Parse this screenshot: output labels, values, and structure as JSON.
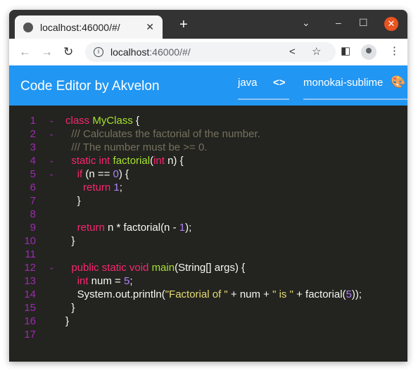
{
  "browser": {
    "tab_title": "localhost:46000/#/",
    "url_host": "localhost",
    "url_rest": ":46000/#/"
  },
  "header": {
    "title": "Code Editor by Akvelon",
    "language": "java",
    "theme": "monokai-sublime"
  },
  "colors": {
    "header": "#2196f3",
    "editor_bg": "#23241f",
    "keyword": "#f92672",
    "function": "#a6e22e",
    "comment": "#75715e",
    "number": "#ae81ff",
    "string": "#e6db74"
  },
  "code": [
    {
      "n": "1",
      "fold": true,
      "t": [
        [
          "kw",
          "class "
        ],
        [
          "fn",
          "MyClass"
        ],
        [
          "tx",
          " {"
        ]
      ]
    },
    {
      "n": "2",
      "fold": true,
      "t": [
        [
          "cm",
          "  /// Calculates the factorial of the number."
        ]
      ]
    },
    {
      "n": "3",
      "fold": false,
      "t": [
        [
          "cm",
          "  /// The number must be >= 0."
        ]
      ]
    },
    {
      "n": "4",
      "fold": true,
      "t": [
        [
          "kw",
          "  static int "
        ],
        [
          "fn",
          "factorial"
        ],
        [
          "tx",
          "("
        ],
        [
          "kw",
          "int"
        ],
        [
          "tx",
          " n) {"
        ]
      ]
    },
    {
      "n": "5",
      "fold": true,
      "t": [
        [
          "kw",
          "    if"
        ],
        [
          "tx",
          " (n == "
        ],
        [
          "num",
          "0"
        ],
        [
          "tx",
          ") {"
        ]
      ]
    },
    {
      "n": "6",
      "fold": false,
      "t": [
        [
          "kw",
          "      return "
        ],
        [
          "num",
          "1"
        ],
        [
          "tx",
          ";"
        ]
      ]
    },
    {
      "n": "7",
      "fold": false,
      "t": [
        [
          "tx",
          "    }"
        ]
      ]
    },
    {
      "n": "8",
      "fold": false,
      "t": []
    },
    {
      "n": "9",
      "fold": false,
      "t": [
        [
          "kw",
          "    return"
        ],
        [
          "tx",
          " n * factorial(n - "
        ],
        [
          "num",
          "1"
        ],
        [
          "tx",
          ");"
        ]
      ]
    },
    {
      "n": "10",
      "fold": false,
      "t": [
        [
          "tx",
          "  }"
        ]
      ]
    },
    {
      "n": "11",
      "fold": false,
      "t": []
    },
    {
      "n": "12",
      "fold": true,
      "t": [
        [
          "kw",
          "  public static void "
        ],
        [
          "fn",
          "main"
        ],
        [
          "tx",
          "(String[] args) {"
        ]
      ]
    },
    {
      "n": "13",
      "fold": false,
      "t": [
        [
          "kw",
          "    int"
        ],
        [
          "tx",
          " num = "
        ],
        [
          "num",
          "5"
        ],
        [
          "tx",
          ";"
        ]
      ]
    },
    {
      "n": "14",
      "fold": false,
      "t": [
        [
          "tx",
          "    System.out.println("
        ],
        [
          "str",
          "\"Factorial of \""
        ],
        [
          "tx",
          " + num + "
        ],
        [
          "str",
          "\" is \""
        ],
        [
          "tx",
          " + factorial("
        ],
        [
          "num",
          "5"
        ],
        [
          "tx",
          "));"
        ]
      ]
    },
    {
      "n": "15",
      "fold": false,
      "t": [
        [
          "tx",
          "  }"
        ]
      ]
    },
    {
      "n": "16",
      "fold": false,
      "t": [
        [
          "tx",
          "}"
        ]
      ]
    },
    {
      "n": "17",
      "fold": false,
      "t": []
    }
  ]
}
